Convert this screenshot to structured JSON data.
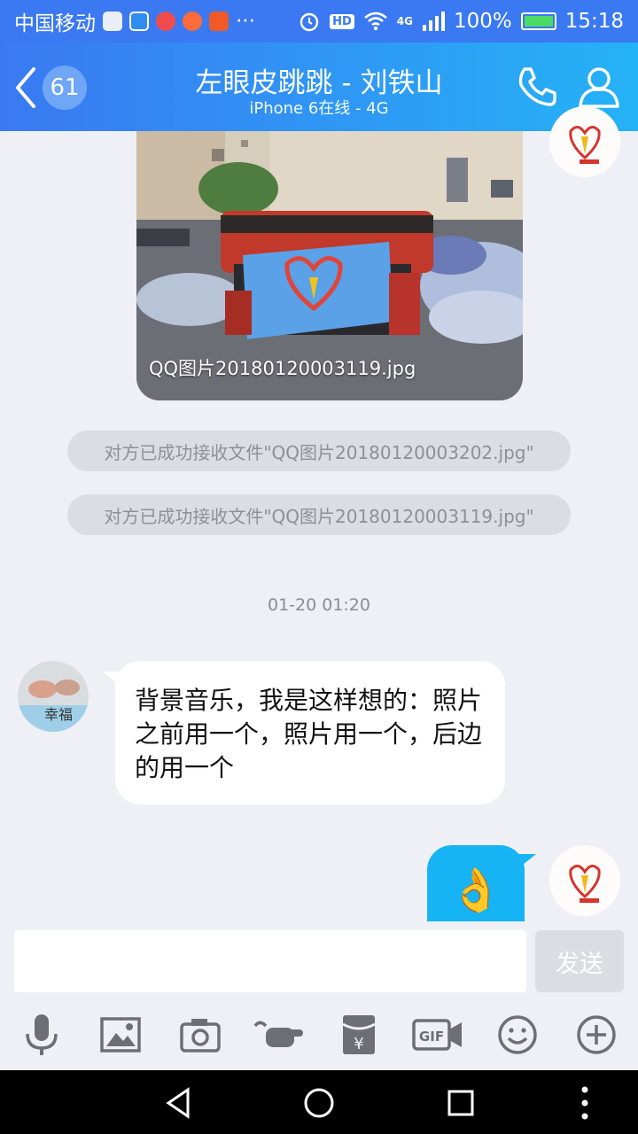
{
  "status_bar": {
    "carrier": "中国移动",
    "more": "···",
    "hd": "HD",
    "network": "4G",
    "battery_percent": "100%",
    "time": "15:18"
  },
  "header": {
    "back_badge": "61",
    "title": "左眼皮跳跳 - 刘铁山",
    "subtitle": "iPhone 6在线 - 4G"
  },
  "chat": {
    "photo_caption": "QQ图片20180120003119.jpg",
    "system_messages": [
      "对方已成功接收文件\"QQ图片20180120003202.jpg\"",
      "对方已成功接收文件\"QQ图片20180120003119.jpg\""
    ],
    "timestamp": "01-20 01:20",
    "incoming_message": "背景音乐，我是这样想的：照片之前用一个，照片用一个，后边的用一个",
    "outgoing_emoji": "👌"
  },
  "input": {
    "value": "",
    "send_label": "发送"
  },
  "toolbar": {
    "gif_label": "GIF",
    "red_packet_label": "¥"
  },
  "icons": {
    "back": "chevron-left-icon",
    "phone": "phone-icon",
    "profile": "user-icon",
    "toolbar": [
      "mic-icon",
      "image-icon",
      "camera-icon",
      "poke-icon",
      "red-packet-icon",
      "gif-icon",
      "emoji-icon",
      "plus-icon"
    ]
  },
  "colors": {
    "header_start": "#3a79f2",
    "header_end": "#25b2f6",
    "outgoing_bubble": "#16b4f4",
    "incoming_bubble": "#ffffff",
    "background": "#eef0f6"
  }
}
